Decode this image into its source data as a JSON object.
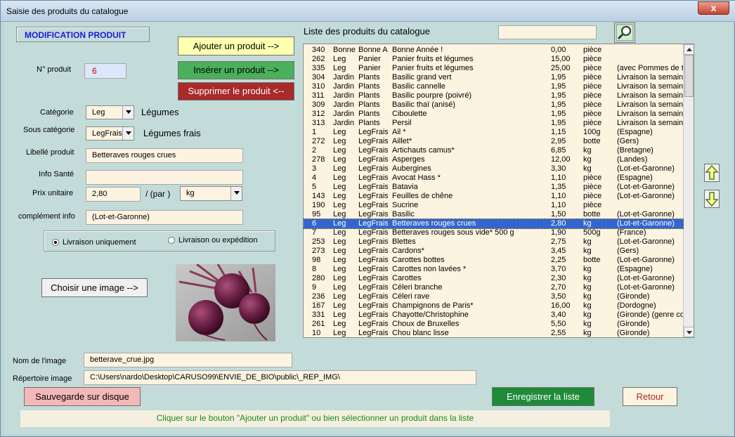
{
  "window": {
    "title": "Saisie des produits du catalogue",
    "close": "x"
  },
  "left": {
    "mode_label": "MODIFICATION PRODUIT",
    "num_label": "N° produit",
    "num_value": "6",
    "cat_label": "Catégorie",
    "cat_value": "Leg",
    "cat_text": "Légumes",
    "subcat_label": "Sous catégorie",
    "subcat_value": "LegFrais",
    "subcat_text": "Légumes frais",
    "libelle_label": "Libellé produit",
    "libelle_value": "Betteraves rouges crues",
    "info_label": "Info Santé",
    "info_value": "",
    "prix_label": "Prix unitaire",
    "prix_value": "2,80",
    "par_label": "/ (par )",
    "unit_value": "kg",
    "comp_label": "complément  info",
    "comp_value": "(Lot-et-Garonne)",
    "radio1": "Livraison uniquement",
    "radio2": "Livraison ou expédition",
    "choose_image": "Choisir une image -->",
    "img_name_label": "Nom de l'image",
    "img_name_value": "betterave_crue.jpg",
    "img_dir_label": "Répertoire image",
    "img_dir_value": "C:\\Users\\nardo\\Desktop\\CARUSO99\\ENVIE_DE_BIO\\public\\_REP_IMG\\"
  },
  "buttons": {
    "add": "Ajouter un produit -->",
    "insert": "Insérer un produit -->",
    "delete": "Supprimer le produit <--",
    "save_disk": "Sauvegarde sur disque",
    "save_list": "Enregistrer la liste",
    "back": "Retour"
  },
  "list": {
    "title": "Liste des produits du catalogue",
    "search": "",
    "selected_index": 19,
    "rows": [
      [
        "340",
        "Bonne",
        "Bonne A",
        "Bonne Année !",
        "0,00",
        "pièce",
        ""
      ],
      [
        "262",
        "Leg",
        "Panier",
        "Panier fruits et légumes",
        "15,00",
        "pièce",
        ""
      ],
      [
        "335",
        "Leg",
        "Panier",
        "Panier fruits et légumes",
        "25,00",
        "pièce",
        "(avec Pommes de t"
      ],
      [
        "304",
        "Jardin",
        "Plants",
        "Basilic grand vert",
        "1,95",
        "pièce",
        "Livraison la semaine"
      ],
      [
        "310",
        "Jardin",
        "Plants",
        "Basilic cannelle",
        "1,95",
        "pièce",
        "Livraison la semaine"
      ],
      [
        "311",
        "Jardin",
        "Plants",
        "Basilic pourpre (poivré)",
        "1,95",
        "pièce",
        "Livraison la semaine"
      ],
      [
        "309",
        "Jardin",
        "Plants",
        "Basilic thaï (anisé)",
        "1,95",
        "pièce",
        "Livraison la semaine"
      ],
      [
        "312",
        "Jardin",
        "Plants",
        "Ciboulette",
        "1,95",
        "pièce",
        "Livraison la semaine"
      ],
      [
        "313",
        "Jardin",
        "Plants",
        "Persil",
        "1,95",
        "pièce",
        "Livraison la semaine"
      ],
      [
        "1",
        "Leg",
        "LegFrais",
        "Ail *",
        "1,15",
        "100g",
        "(Espagne)"
      ],
      [
        "272",
        "Leg",
        "LegFrais",
        "Aillet*",
        "2,95",
        "botte",
        "(Gers)"
      ],
      [
        "2",
        "Leg",
        "LegFrais",
        "Artichauts  camus*",
        "6,85",
        "kg",
        "(Bretagne)"
      ],
      [
        "278",
        "Leg",
        "LegFrais",
        "Asperges",
        "12,00",
        "kg",
        "(Landes)"
      ],
      [
        "3",
        "Leg",
        "LegFrais",
        "Aubergines",
        "3,30",
        "kg",
        "(Lot-et-Garonne)"
      ],
      [
        "4",
        "Leg",
        "LegFrais",
        "Avocat Hass *",
        "1,10",
        "pièce",
        "(Espagne)"
      ],
      [
        "5",
        "Leg",
        "LegFrais",
        "Batavia",
        "1,35",
        "pièce",
        "(Lot-et-Garonne)"
      ],
      [
        "143",
        "Leg",
        "LegFrais",
        "Feuilles de chêne",
        "1,10",
        "pièce",
        "(Lot-et-Garonne)"
      ],
      [
        "190",
        "Leg",
        "LegFrais",
        "Sucrine",
        "1,10",
        "pièce",
        ""
      ],
      [
        "95",
        "Leg",
        "LegFrais",
        "Basilic",
        "1,50",
        "botte",
        "(Lot-et-Garonne)"
      ],
      [
        "6",
        "Leg",
        "LegFrais",
        "Betteraves rouges crues",
        "2,80",
        "kg",
        "(Lot-et-Garonne)"
      ],
      [
        "7",
        "Leg",
        "LegFrais",
        "Betteraves rouges sous vide* 500 g",
        "1,90",
        "500g",
        "(France)"
      ],
      [
        "253",
        "Leg",
        "LegFrais",
        "Blettes",
        "2,75",
        "kg",
        "(Lot-et-Garonne)"
      ],
      [
        "273",
        "Leg",
        "LegFrais",
        "Cardons*",
        "3,45",
        "kg",
        "(Gers)"
      ],
      [
        "98",
        "Leg",
        "LegFrais",
        "Carottes bottes",
        "2,25",
        "botte",
        "(Lot-et-Garonne)"
      ],
      [
        "8",
        "Leg",
        "LegFrais",
        "Carottes non lavées *",
        "3,70",
        "kg",
        "(Espagne)"
      ],
      [
        "280",
        "Leg",
        "LegFrais",
        "Carottes",
        "2,30",
        "kg",
        "(Lot-et-Garonne)"
      ],
      [
        "9",
        "Leg",
        "LegFrais",
        "Céleri branche",
        "2,70",
        "kg",
        "(Lot-et-Garonne)"
      ],
      [
        "236",
        "Leg",
        "LegFrais",
        "Céleri rave",
        "3,50",
        "kg",
        "(Gironde)"
      ],
      [
        "167",
        "Leg",
        "LegFrais",
        "Champignons de Paris*",
        "16,00",
        "kg",
        "(Dordogne)"
      ],
      [
        "331",
        "Leg",
        "LegFrais",
        "Chayotte/Christophine",
        "3,40",
        "kg",
        "(Gironde) (genre co"
      ],
      [
        "261",
        "Leg",
        "LegFrais",
        "Choux de Bruxelles",
        "5,50",
        "kg",
        "(Gironde)"
      ],
      [
        "10",
        "Leg",
        "LegFrais",
        "Chou blanc lisse",
        "2,55",
        "kg",
        "(Gironde)"
      ]
    ]
  },
  "status": "Cliquer sur le bouton \"Ajouter un produit\" ou bien sélectionner un produit dans la liste",
  "icons": {
    "search": "magnifier-icon",
    "up": "up-arrow-icon",
    "down": "down-arrow-icon"
  }
}
